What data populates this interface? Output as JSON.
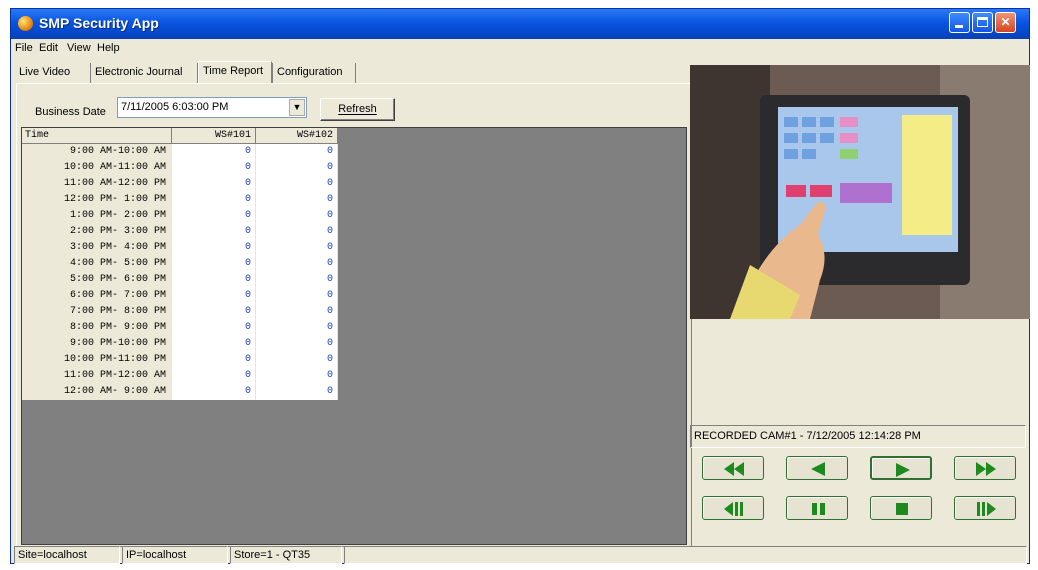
{
  "window": {
    "title": "SMP Security App"
  },
  "menu": [
    {
      "label": "File"
    },
    {
      "label": "Edit"
    },
    {
      "label": "View"
    },
    {
      "label": "Help"
    }
  ],
  "tabs": [
    {
      "label": "Live Video"
    },
    {
      "label": "Electronic Journal"
    },
    {
      "label": "Time Report",
      "active": true
    },
    {
      "label": "Configuration"
    }
  ],
  "report": {
    "business_date_label": "Business Date",
    "business_date_value": "7/11/2005 6:03:00 PM",
    "refresh_label": "Refresh",
    "columns": [
      "Time",
      "WS#101",
      "WS#102"
    ],
    "rows": [
      {
        "time": "9:00 AM-10:00 AM",
        "ws101": "0",
        "ws102": "0"
      },
      {
        "time": "10:00 AM-11:00 AM",
        "ws101": "0",
        "ws102": "0"
      },
      {
        "time": "11:00 AM-12:00 PM",
        "ws101": "0",
        "ws102": "0"
      },
      {
        "time": "12:00 PM- 1:00 PM",
        "ws101": "0",
        "ws102": "0"
      },
      {
        "time": "1:00 PM- 2:00 PM",
        "ws101": "0",
        "ws102": "0"
      },
      {
        "time": "2:00 PM- 3:00 PM",
        "ws101": "0",
        "ws102": "0"
      },
      {
        "time": "3:00 PM- 4:00 PM",
        "ws101": "0",
        "ws102": "0"
      },
      {
        "time": "4:00 PM- 5:00 PM",
        "ws101": "0",
        "ws102": "0"
      },
      {
        "time": "5:00 PM- 6:00 PM",
        "ws101": "0",
        "ws102": "0"
      },
      {
        "time": "6:00 PM- 7:00 PM",
        "ws101": "0",
        "ws102": "0"
      },
      {
        "time": "7:00 PM- 8:00 PM",
        "ws101": "0",
        "ws102": "0"
      },
      {
        "time": "8:00 PM- 9:00 PM",
        "ws101": "0",
        "ws102": "0"
      },
      {
        "time": "9:00 PM-10:00 PM",
        "ws101": "0",
        "ws102": "0"
      },
      {
        "time": "10:00 PM-11:00 PM",
        "ws101": "0",
        "ws102": "0"
      },
      {
        "time": "11:00 PM-12:00 AM",
        "ws101": "0",
        "ws102": "0"
      },
      {
        "time": "12:00 AM- 9:00 AM",
        "ws101": "0",
        "ws102": "0"
      }
    ]
  },
  "video": {
    "status": "RECORDED CAM#1 - 7/12/2005 12:14:28 PM",
    "controls": [
      {
        "name": "rewind-fast-button",
        "icon": "fast-rewind-icon"
      },
      {
        "name": "rewind-button",
        "icon": "rewind-icon"
      },
      {
        "name": "play-button",
        "icon": "play-icon"
      },
      {
        "name": "fast-forward-button",
        "icon": "fast-forward-icon"
      },
      {
        "name": "step-back-button",
        "icon": "step-back-icon"
      },
      {
        "name": "pause-button",
        "icon": "pause-icon"
      },
      {
        "name": "stop-button",
        "icon": "stop-icon"
      },
      {
        "name": "step-forward-button",
        "icon": "step-forward-icon"
      }
    ]
  },
  "status": {
    "site": "Site=localhost",
    "ip": "IP=localhost",
    "store": "Store=1 - QT35"
  },
  "colors": {
    "titlebar": "#0a54e0",
    "button_icon": "#1e8a1e",
    "grid_value": "#2040c0"
  }
}
